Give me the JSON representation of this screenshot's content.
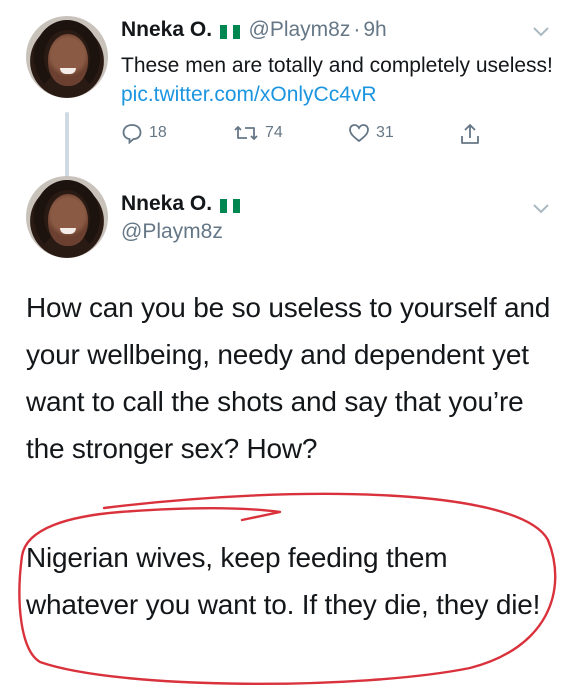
{
  "tweet1": {
    "name": "Nneka O.",
    "handle": "@Playm8z",
    "separator": "·",
    "time": "9h",
    "text": "These men are totally and completely useless! ",
    "link": "pic.twitter.com/xOnlyCc4vR",
    "replies": "18",
    "retweets": "74",
    "likes": "31"
  },
  "tweet2": {
    "name": "Nneka O.",
    "handle": "@Playm8z",
    "paragraph1": "How can you be so useless to yourself and your wellbeing, needy and dependent yet want to call the shots and say that you’re the stronger sex? How?",
    "paragraph2": "Nigerian wives, keep feeding them whatever you want to. If they die, they die!"
  },
  "colors": {
    "text": "#14171a",
    "secondary": "#657786",
    "link": "#1b95e0",
    "annotation": "#d9323c",
    "flag_green": "#008751"
  }
}
